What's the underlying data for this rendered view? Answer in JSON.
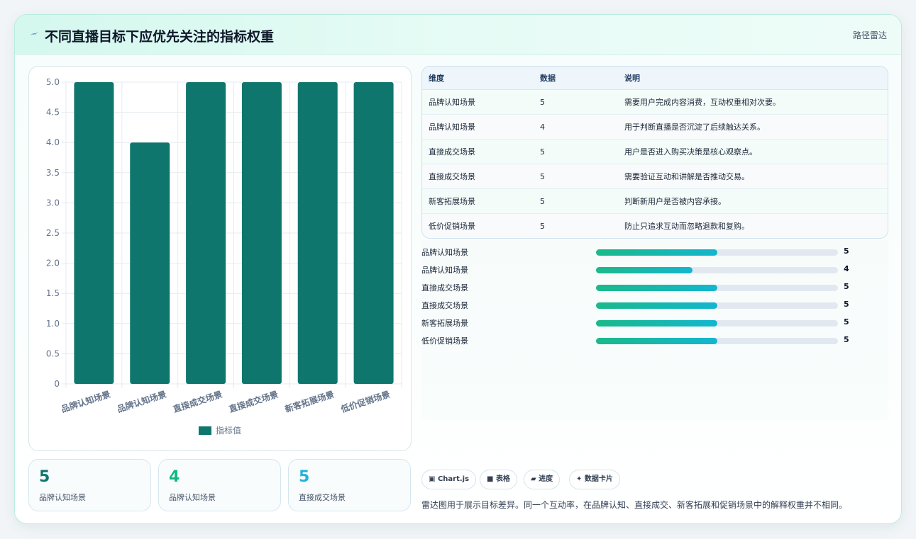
{
  "header": {
    "title": "不同直播目标下应优先关注的指标权重",
    "tag": "路径雷达"
  },
  "chart_data": {
    "type": "bar",
    "categories": [
      "品牌认知场景",
      "品牌认知场景",
      "直接成交场景",
      "直接成交场景",
      "新客拓展场景",
      "低价促销场景"
    ],
    "series": [
      {
        "name": "指标值",
        "values": [
          5,
          4,
          5,
          5,
          5,
          5
        ]
      }
    ],
    "ylim": [
      0,
      5
    ],
    "yticks": [
      "0",
      "0.5",
      "1.0",
      "1.5",
      "2.0",
      "2.5",
      "3.0",
      "3.5",
      "4.0",
      "4.5",
      "5.0"
    ],
    "grid": true,
    "legend": "bottom",
    "color": "#0f766e"
  },
  "stats": [
    {
      "value": "5",
      "label": "品牌认知场景",
      "color": "#0f766e"
    },
    {
      "value": "4",
      "label": "品牌认知场景",
      "color": "#10b981"
    },
    {
      "value": "5",
      "label": "直接成交场景",
      "color": "#22b3dc"
    }
  ],
  "table": {
    "headers": [
      "维度",
      "数据",
      "说明"
    ],
    "rows": [
      [
        "品牌认知场景",
        "5",
        "需要用户完成内容消费，互动权重相对次要。"
      ],
      [
        "品牌认知场景",
        "4",
        "用于判断直播是否沉淀了后续触达关系。"
      ],
      [
        "直接成交场景",
        "5",
        "用户是否进入购买决策是核心观察点。"
      ],
      [
        "直接成交场景",
        "5",
        "需要验证互动和讲解是否推动交易。"
      ],
      [
        "新客拓展场景",
        "5",
        "判断新用户是否被内容承接。"
      ],
      [
        "低价促销场景",
        "5",
        "防止只追求互动而忽略退款和复购。"
      ]
    ]
  },
  "progress": {
    "max": 10,
    "items": [
      {
        "label": "品牌认知场景",
        "value": 5
      },
      {
        "label": "品牌认知场景",
        "value": 4
      },
      {
        "label": "直接成交场景",
        "value": 5
      },
      {
        "label": "直接成交场景",
        "value": 5
      },
      {
        "label": "新客拓展场景",
        "value": 5
      },
      {
        "label": "低价促销场景",
        "value": 5
      }
    ]
  },
  "chips": [
    "Chart.js",
    "表格",
    "进度",
    "数据卡片"
  ],
  "footnote": "雷达图用于展示目标差异。同一个互动率，在品牌认知、直接成交、新客拓展和促销场景中的解释权重并不相同。"
}
